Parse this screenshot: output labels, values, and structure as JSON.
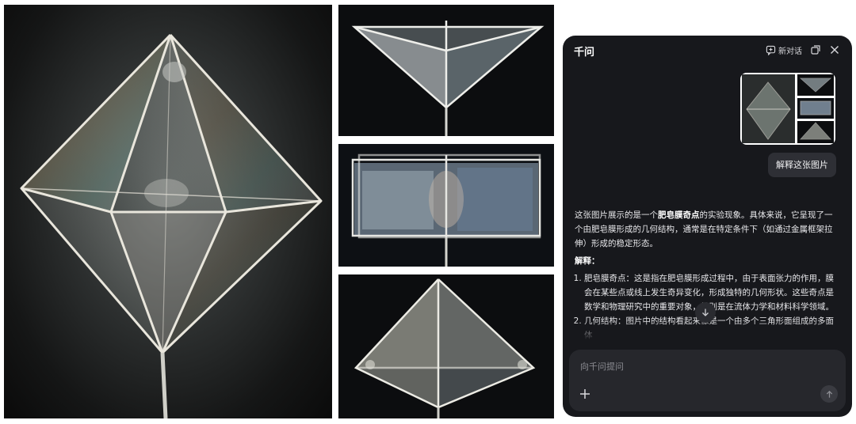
{
  "chat": {
    "title": "千问",
    "new_chat_label": "新对话",
    "user_message": "解释这张图片",
    "answer": {
      "intro_pre": "这张图片展示的是一个",
      "intro_bold": "肥皂膜奇点",
      "intro_post": "的实验现象。具体来说，它呈现了一个由肥皂膜形成的几何结构，通常是在特定条件下（如通过金属框架拉伸）形成的稳定形态。",
      "heading": "解释：",
      "items": [
        "肥皂膜奇点：这是指在肥皂膜形成过程中，由于表面张力的作用，膜会在某些点或线上发生奇异变化，形成独特的几何形状。这些奇点是数学和物理研究中的重要对象，特别是在流体力学和材料科学领域。",
        "几何结构：图片中的结构看起来像是一个由多个三角形面组成的多面体"
      ]
    },
    "input_placeholder": "向千问提问"
  },
  "icons": {
    "new_chat": "new-chat-icon",
    "popout": "popout-icon",
    "close": "close-icon",
    "scroll_down": "arrow-down-icon",
    "plus": "plus-icon",
    "send": "arrow-up-icon"
  }
}
